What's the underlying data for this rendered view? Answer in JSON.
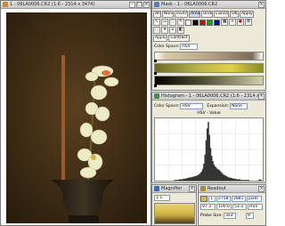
{
  "image_window": {
    "title": "1 - 06LA0006.CR2 (1:6 - 2314 x 3474)"
  },
  "mask_window": {
    "title": "Mask - 1 - 06LA0006.CR2",
    "toolbar_buttons": [
      "All",
      "None",
      "Invert",
      "Area",
      "Undo",
      "Cancel",
      "OK",
      "Apply"
    ],
    "tabs": [
      "Apply",
      "Contract"
    ],
    "color_space_label": "Color Space:",
    "color_space_value": "HSV"
  },
  "histogram_window": {
    "title": "Histogram - 1 - 06LA0006.CR2 (1:6 - 2314 x",
    "color_space_label": "Color Space:",
    "color_space_value": "HSV",
    "expansion_label": "Expansion:",
    "expansion_value": "None",
    "channel_label": "HSV - Value"
  },
  "magnifier_window": {
    "title": "Magnifier",
    "zoom_value": "1:1"
  },
  "readout_window": {
    "title": "Readout",
    "values_row1": [
      "1",
      "2758",
      "2881",
      "pixel"
    ],
    "values_row2": [
      "97.3",
      "100.0",
      "53.3",
      "HSV"
    ],
    "probe_label": "Probe Size:",
    "probe_value": "3x3",
    "last_value": "9"
  },
  "colors": {
    "image_background": "#3e2c14",
    "flower": "#eeeec8",
    "vase": "#2c2418",
    "swatch_red": "#dd0000",
    "swatch_green": "#00aa00",
    "swatch_blue": "#0000cc",
    "histogram_bg": "#ffffff",
    "magnifier_fill": "#d7bf4d"
  },
  "histogram_profile": [
    0,
    0,
    0,
    0,
    0,
    0,
    0,
    0,
    0,
    0,
    0,
    0,
    0,
    0,
    0,
    0,
    0,
    1,
    1,
    1,
    1,
    2,
    2,
    2,
    2,
    3,
    3,
    3,
    4,
    4,
    5,
    5,
    5,
    6,
    6,
    7,
    7,
    8,
    9,
    10,
    12,
    14,
    18,
    26,
    40,
    62,
    80,
    90,
    70,
    50,
    38,
    30,
    25,
    22,
    20,
    18,
    17,
    16,
    14,
    12,
    10,
    9,
    8,
    7,
    6,
    5,
    5,
    4,
    4,
    3,
    3,
    3,
    2,
    2,
    2,
    2,
    1,
    1,
    1,
    1,
    1,
    1,
    1,
    1,
    0,
    0,
    0,
    0,
    0,
    0,
    0,
    0,
    1,
    2,
    1,
    0
  ]
}
